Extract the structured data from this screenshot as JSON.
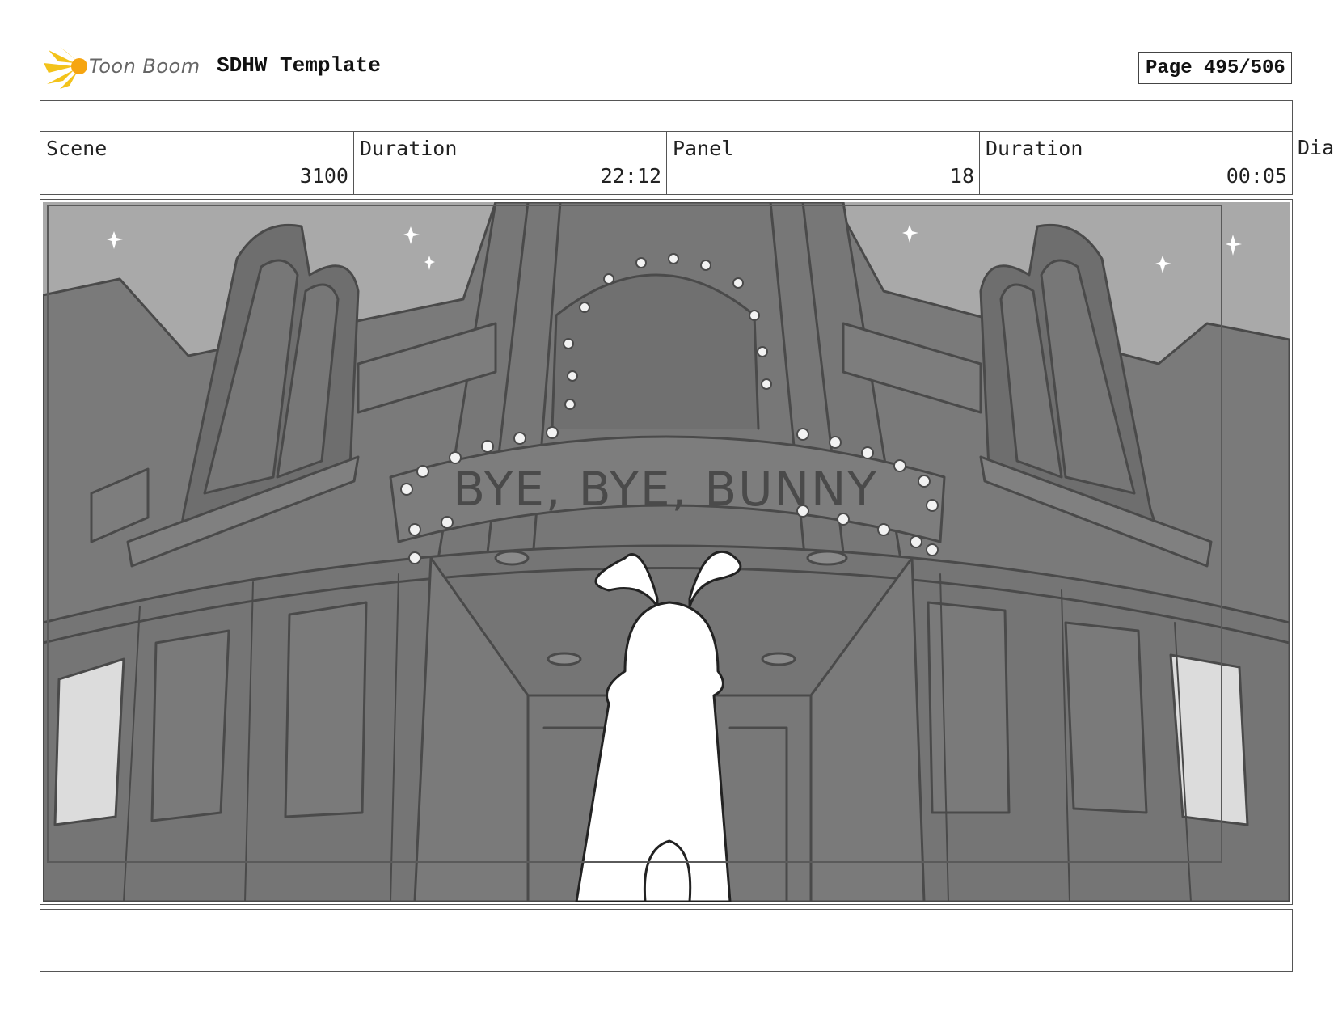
{
  "header": {
    "brand": "Toon Boom",
    "title": "SDHW Template",
    "page": "Page 495/506"
  },
  "info": {
    "scene_label": "Scene",
    "scene_value": "3100",
    "scene_duration_label": "Duration",
    "scene_duration_value": "22:12",
    "panel_label": "Panel",
    "panel_value": "18",
    "panel_duration_label": "Duration",
    "panel_duration_value": "00:05",
    "dialogue_label": "Dia"
  },
  "panel": {
    "marquee_text": "BYE, BYE, BUNNY"
  },
  "colors": {
    "sky": "#a9a9a9",
    "building": "#7a7a7a",
    "building_dark": "#6c6c6c",
    "line": "#4a4a4a",
    "bulb": "#f2f2f2",
    "bunny": "#ffffff"
  },
  "icons": {
    "logo": "toon-boom-starburst-icon"
  }
}
